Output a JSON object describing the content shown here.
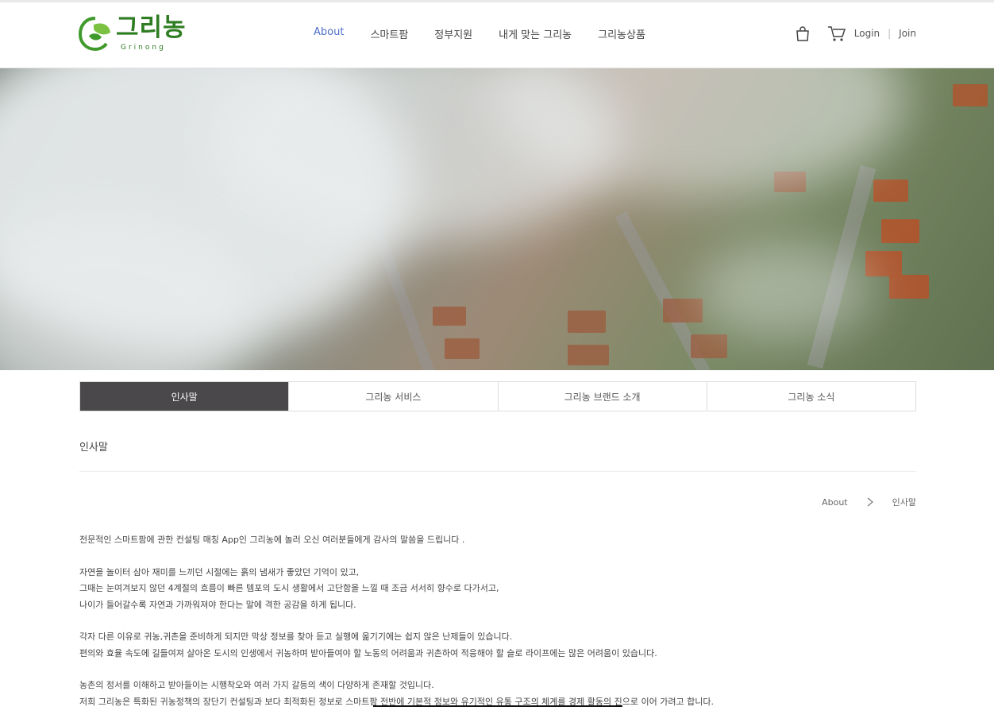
{
  "brand": {
    "name": "그리농",
    "sub": "Grinong"
  },
  "nav": {
    "items": [
      "About",
      "스마트팜",
      "정부지원",
      "내게 맞는 그리농",
      "그리농상품"
    ]
  },
  "util": {
    "login": "Login",
    "sep": "|",
    "join": "Join"
  },
  "tabs": [
    "인사말",
    "그리농 서비스",
    "그리농 브랜드 소개",
    "그리농 소식"
  ],
  "section": {
    "title": "인사말"
  },
  "breadcrumb": {
    "parent": "About",
    "current": "인사말"
  },
  "content": {
    "p1": [
      "전문적인 스마트팜에 관한 컨설팅 매칭 App인 그리농에 놀러 오신 여러분들에게 감사의 말씀을 드립니다 ."
    ],
    "p2": [
      "자연을 놀이터 삼아 재미를 느끼던 시절에는 흙의 냄새가 좋았던 기억이 있고,",
      "그때는 눈여겨보지 않던 4계절의 흐름이 빠른 템포의 도시 생활에서 고단함을 느낄 때 조금 서서히 향수로 다가서고,",
      "나이가 들어갈수록 자연과 가까워져야 한다는 말에 격한 공감을 하게 됩니다."
    ],
    "p3": [
      "각자 다른 이유로 귀농,귀촌을 준비하게 되지만 막상 정보를 찾아 듣고 실행에 옮기기에는 쉽지 않은 난제들이 있습니다.",
      "편의와 효율 속도에 길들여져 살아온 도시의 인생에서 귀농하며 받아들여야 할 노동의 어려움과 귀촌하여 적응해야 할 슬로 라이프에는 많은 어려움이 있습니다."
    ],
    "p4": [
      "농촌의 정서를 이해하고 받아들이는 시행착오와 여러 가지 갈등의 색이 다양하게 존재할 것입니다.",
      "저희 그리농은 특화된 귀농정책의 장단기 컨설팅과 보다 최적화된 정보로 스마트팜 전반에 기본적 정보와 유기적인 유통 구조의 체계를  경제 활동의 진으로 이어 가려고 합니다."
    ]
  }
}
